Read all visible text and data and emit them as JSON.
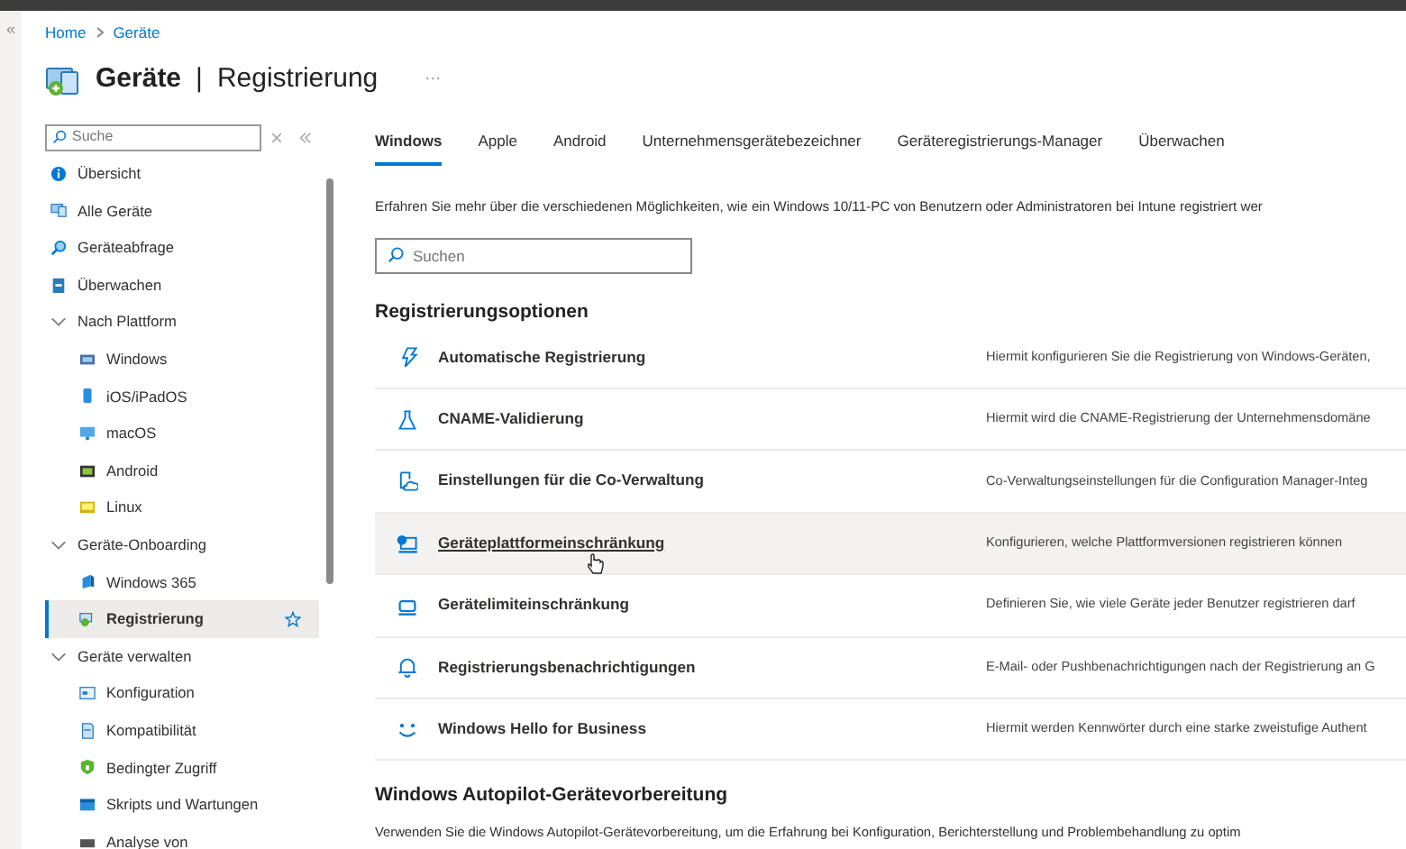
{
  "breadcrumb": [
    {
      "label": "Home"
    },
    {
      "label": "Geräte"
    }
  ],
  "collapse_all": "«",
  "page_title": {
    "main": "Geräte",
    "separator": "|",
    "sub": "Registrierung",
    "more": "···"
  },
  "sidebar": {
    "search_placeholder": "Suche",
    "items": [
      {
        "label": "Übersicht",
        "selected": false
      },
      {
        "label": "Alle Geräte",
        "selected": false
      },
      {
        "label": "Geräteabfrage",
        "selected": false
      },
      {
        "label": "Überwachen",
        "selected": false
      },
      {
        "label": "Nach Plattform",
        "expanded": true,
        "children": [
          {
            "label": "Windows",
            "selected": false
          },
          {
            "label": "iOS/iPadOS",
            "selected": false
          },
          {
            "label": "macOS",
            "selected": false
          },
          {
            "label": "Android",
            "selected": false
          },
          {
            "label": "Linux",
            "selected": false
          }
        ]
      },
      {
        "label": "Geräte-Onboarding",
        "expanded": true,
        "children": [
          {
            "label": "Windows 365",
            "selected": false
          },
          {
            "label": "Registrierung",
            "selected": true
          }
        ]
      },
      {
        "label": "Geräte verwalten",
        "expanded": true,
        "children": [
          {
            "label": "Konfiguration",
            "selected": false
          },
          {
            "label": "Kompatibilität",
            "selected": false
          },
          {
            "label": "Bedingter Zugriff",
            "selected": false
          },
          {
            "label": "Skripts und Wartungen",
            "selected": false
          },
          {
            "label": "Analyse von",
            "selected": false
          }
        ]
      }
    ]
  },
  "tabs": [
    {
      "label": "Windows",
      "selected": true
    },
    {
      "label": "Apple",
      "selected": false
    },
    {
      "label": "Android",
      "selected": false
    },
    {
      "label": "Unternehmensgerätebezeichner",
      "selected": false
    },
    {
      "label": "Geräteregistrierungs-Manager",
      "selected": false
    },
    {
      "label": "Überwachen",
      "selected": false
    }
  ],
  "intro": "Erfahren Sie mehr über die verschiedenen Möglichkeiten, wie ein Windows 10/11-PC von Benutzern oder Administratoren bei Intune registriert wer",
  "search": {
    "placeholder": "Suchen"
  },
  "options_section": {
    "title": "Registrierungsoptionen",
    "options": [
      {
        "title": "Automatische Registrierung",
        "description": "Hiermit konfigurieren Sie die Registrierung von Windows-Geräten,",
        "hovered": false
      },
      {
        "title": "CNAME-Validierung",
        "description": "Hiermit wird die CNAME-Registrierung der Unternehmensdomäne",
        "hovered": false
      },
      {
        "title": "Einstellungen für die Co-Verwaltung",
        "description": "Co-Verwaltungseinstellungen für die Configuration Manager-Integ",
        "hovered": false
      },
      {
        "title": "Geräteplattformeinschränkung",
        "description": "Konfigurieren, welche Plattformversionen registrieren können",
        "hovered": true
      },
      {
        "title": "Gerätelimiteinschränkung",
        "description": "Definieren Sie, wie viele Geräte jeder Benutzer registrieren darf",
        "hovered": false
      },
      {
        "title": "Registrierungsbenachrichtigungen",
        "description": "E-Mail- oder Pushbenachrichtigungen nach der Registrierung an G",
        "hovered": false
      },
      {
        "title": "Windows Hello for Business",
        "description": "Hiermit werden Kennwörter durch eine starke zweistufige Authent",
        "hovered": false
      }
    ]
  },
  "autopilot_section": {
    "title": "Windows Autopilot-Gerätevorbereitung",
    "text": "Verwenden Sie die Windows Autopilot-Gerätevorbereitung, um die Erfahrung bei Konfiguration, Berichterstellung und Problembehandlung zu optim"
  }
}
